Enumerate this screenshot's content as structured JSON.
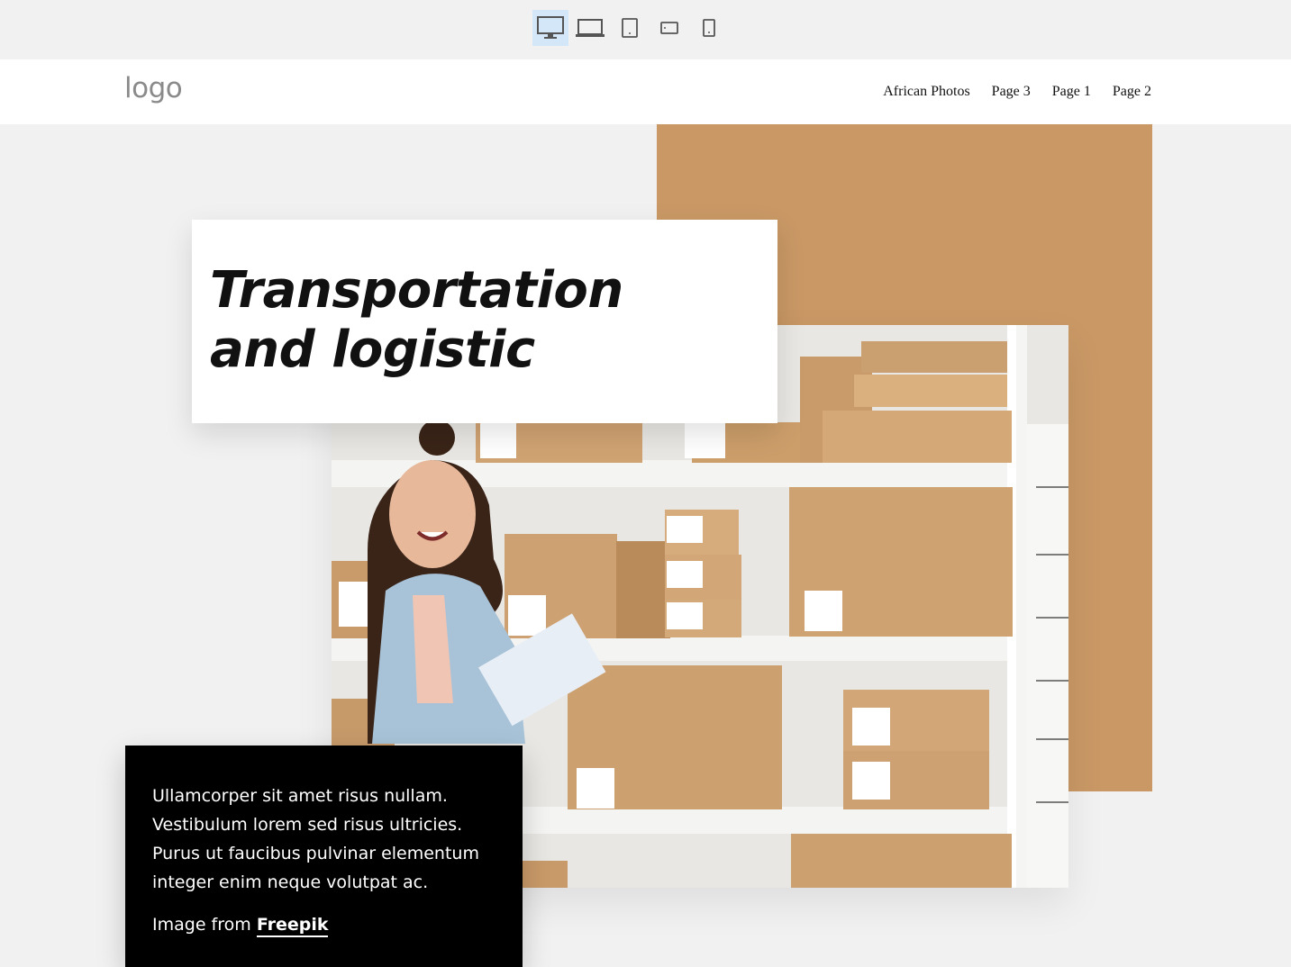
{
  "toolbar": {
    "devices": [
      {
        "name": "desktop",
        "active": true
      },
      {
        "name": "laptop",
        "active": false
      },
      {
        "name": "tablet-portrait",
        "active": false
      },
      {
        "name": "tablet-landscape",
        "active": false
      },
      {
        "name": "mobile",
        "active": false
      }
    ],
    "active_color": "#d4e7f8"
  },
  "header": {
    "logo": "logo",
    "nav": [
      "African Photos",
      "Page 3",
      "Page 1",
      "Page 2"
    ]
  },
  "hero": {
    "title_line1": "Transportation",
    "title_line2": "and logistic",
    "body": "Ullamcorper sit amet risus nullam. Vestibulum lorem sed risus ultricies. Purus ut faucibus pulvinar elementum integer enim neque volutpat ac.",
    "credit_prefix": "Image from",
    "credit_link": "Freepik",
    "accent_color": "#c99865"
  }
}
